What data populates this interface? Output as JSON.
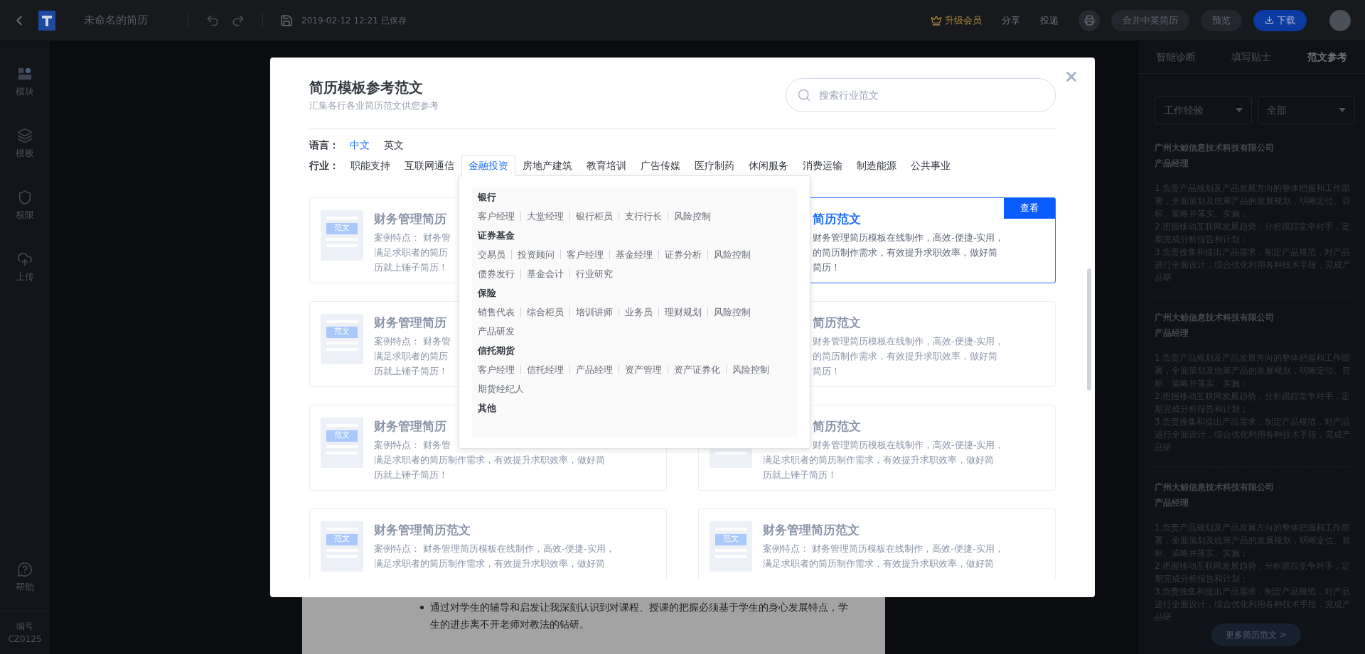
{
  "top_bar": {
    "title": "未命名的简历",
    "saved": "2019-02-12 12:21 已保存",
    "upgrade": "升级会员",
    "links": [
      "分享",
      "投递"
    ],
    "pills": [
      {
        "label": "合并中英简历",
        "kind": "outline"
      },
      {
        "label": "预览",
        "kind": "outline"
      },
      {
        "label": "下载",
        "kind": "primary"
      }
    ]
  },
  "sidebar": {
    "items": [
      "模块",
      "模板",
      "权限",
      "上传"
    ],
    "help": "帮助",
    "code_label": "编号",
    "code": "CZ0125"
  },
  "document": {
    "bullet": "通过对学生的辅导和启发让我深刻认识到对课程、授课的把握必须基于学生的身心发展特点，学生的进步离不开老师对教法的钻研。"
  },
  "modal": {
    "title": "简历模板参考范文",
    "subtitle": "汇集各行各业简历范文供您参考",
    "search": {
      "placeholder": "搜索行业范文"
    },
    "language": {
      "label": "语言：",
      "options": [
        {
          "label": "中文",
          "selected": true
        },
        {
          "label": "英文",
          "selected": false
        }
      ]
    },
    "industry": {
      "label": "行业：",
      "options": [
        {
          "label": "职能支持",
          "selected": false
        },
        {
          "label": "互联网通信",
          "selected": false
        },
        {
          "label": "金融投资",
          "selected": true
        },
        {
          "label": "房地产建筑",
          "selected": false
        },
        {
          "label": "教育培训",
          "selected": false
        },
        {
          "label": "广告传媒",
          "selected": false
        },
        {
          "label": "医疗制药",
          "selected": false
        },
        {
          "label": "休闲服务",
          "selected": false
        },
        {
          "label": "消费运输",
          "selected": false
        },
        {
          "label": "制造能源",
          "selected": false
        },
        {
          "label": "公共事业",
          "selected": false
        }
      ]
    },
    "dropdown": {
      "groups": [
        {
          "title": "银行",
          "items": [
            "客户经理",
            "大堂经理",
            "银行柜员",
            "支行行长",
            "风险控制"
          ]
        },
        {
          "title": "证券基金",
          "items": [
            "交易员",
            "投资顾问",
            "客户经理",
            "基金经理",
            "证券分析",
            "风险控制",
            "债券发行",
            "基金会计",
            "行业研究"
          ]
        },
        {
          "title": "保险",
          "items": [
            "销售代表",
            "综合柜员",
            "培训讲师",
            "业务员",
            "理财规划",
            "风险控制",
            "产品研发"
          ]
        },
        {
          "title": "信托期货",
          "items": [
            "客户经理",
            "信托经理",
            "产品经理",
            "资产管理",
            "资产证券化",
            "风险控制",
            "期货经纪人"
          ]
        },
        {
          "title": "其他"
        }
      ]
    },
    "cards": [
      {
        "title": {
          "text": "财务管理简历",
          "kind": "cut_end"
        },
        "label": "范文",
        "hovered": false,
        "lines": [
          {
            "text": "案例特点： 财务管",
            "kind": "cut_end"
          },
          {
            "text": "满足求职者的简历",
            "kind": "cut_end"
          },
          {
            "text": "历就上锤子简历！",
            "kind": "cut_end"
          }
        ]
      },
      {
        "title": {
          "text": "简历范文",
          "kind": "cut_start"
        },
        "hovered": true,
        "action": "查看",
        "lines": [
          {
            "text": "财务管理简历模板在线制作，高效-便捷-实用，",
            "kind": "cut_start"
          },
          {
            "text": "的简历制作需求，有效提升求职效率，做好简",
            "kind": "cut_start"
          },
          {
            "text": "简历！",
            "kind": "cut_start"
          }
        ]
      },
      {
        "title": {
          "text": "财务管理简历",
          "kind": "cut_end"
        },
        "label": "范文",
        "hovered": false,
        "lines": [
          {
            "text": "案例特点： 财务管",
            "kind": "cut_end"
          },
          {
            "text": "满足求职者的简历",
            "kind": "cut_end"
          },
          {
            "text": "历就上锤子简历！",
            "kind": "cut_end"
          }
        ]
      },
      {
        "title": {
          "text": "简历范文",
          "kind": "cut_start"
        },
        "hovered": false,
        "lines": [
          {
            "text": "财务管理简历模板在线制作，高效-便捷-实用，",
            "kind": "cut_start"
          },
          {
            "text": "的简历制作需求，有效提升求职效率，做好简",
            "kind": "cut_start"
          },
          {
            "text": "简历！",
            "kind": "cut_start"
          }
        ]
      },
      {
        "title": {
          "text": "财务管理简历",
          "kind": "cut_end"
        },
        "label": "范文",
        "hovered": false,
        "lines": [
          {
            "text": "案例特点： 财务管",
            "kind": "cut_end"
          },
          {
            "text": "满足求职者的简历制作需求，有效提升求职效率，做好简",
            "kind": "whole"
          },
          {
            "text": "历就上锤子简历！",
            "kind": "whole"
          }
        ]
      },
      {
        "title": {
          "text": "简历范文",
          "kind": "cut_start"
        },
        "hovered": false,
        "lines": [
          {
            "text": "财务管理简历模板在线制作，高效-便捷-实用，",
            "kind": "cut_start"
          },
          {
            "text": "满足求职者的简历制作需求，有效提升求职效率，做好简",
            "kind": "whole"
          },
          {
            "text": "历就上锤子简历！",
            "kind": "whole"
          }
        ]
      },
      {
        "title": {
          "text": "财务管理简历范文",
          "kind": "whole"
        },
        "label": "范文",
        "hovered": false,
        "lines": [
          {
            "text": "案例特点： 财务管理简历模板在线制作，高效-便捷-实用，",
            "kind": "whole"
          },
          {
            "text": "满足求职者的简历制作需求，有效提升求职效率，做好简",
            "kind": "whole"
          }
        ]
      },
      {
        "title": {
          "text": "财务管理简历范文",
          "kind": "whole"
        },
        "label": "范文",
        "hovered": false,
        "lines": [
          {
            "text": "案例特点： 财务管理简历模板在线制作，高效-便捷-实用，",
            "kind": "whole"
          },
          {
            "text": "满足求职者的简历制作需求，有效提升求职效率，做好简",
            "kind": "whole"
          }
        ]
      }
    ]
  },
  "right_panel": {
    "tabs": [
      {
        "label": "智能诊断",
        "selected": false
      },
      {
        "label": "填写贴士",
        "selected": false
      },
      {
        "label": "范文参考",
        "selected": true
      }
    ],
    "filters": [
      "工作经验",
      "全部"
    ],
    "entries": [
      {
        "company": "广州大鲸信息技术科技有限公司",
        "role": "产品经理",
        "lines": [
          "1.负责产品规划及产品发展方向的整体把握和工作部署，全面策划及统筹产品的发展规划，明晰定位、目标、策略并落实、实施；",
          "2.把握移动互联网发展趋势，分析跟踪竞争对手，定期完成分析报告和计划；",
          "3.负责搜集和提出产品需求，制定产品规范，对产品进行全面设计，综合优化利用各种技术手段，完成产品研"
        ]
      },
      {
        "company": "广州大鲸信息技术科技有限公司",
        "role": "产品经理",
        "lines": [
          "1.负责产品规划及产品发展方向的整体把握和工作部署，全面策划及统筹产品的发展规划，明晰定位、目标、策略并落实、实施；",
          "2.把握移动互联网发展趋势，分析跟踪竞争对手，定期完成分析报告和计划；",
          "3.负责搜集和提出产品需求，制定产品规范，对产品进行全面设计，综合优化利用各种技术手段，完成产品研"
        ]
      },
      {
        "company": "广州大鲸信息技术科技有限公司",
        "role": "产品经理",
        "lines": [
          "1.负责产品规划及产品发展方向的整体把握和工作部署，全面策划及统筹产品的发展规划，明晰定位、目标、策略并落实、实施；",
          "2.把握移动互联网发展趋势，分析跟踪竞争对手，定期完成分析报告和计划；",
          "3.负责搜集和提出产品需求，制定产品规范，对产品进行全面设计，综合优化利用各种技术手段，完成产品研"
        ]
      }
    ],
    "more_button": "更多简历范文 >"
  }
}
